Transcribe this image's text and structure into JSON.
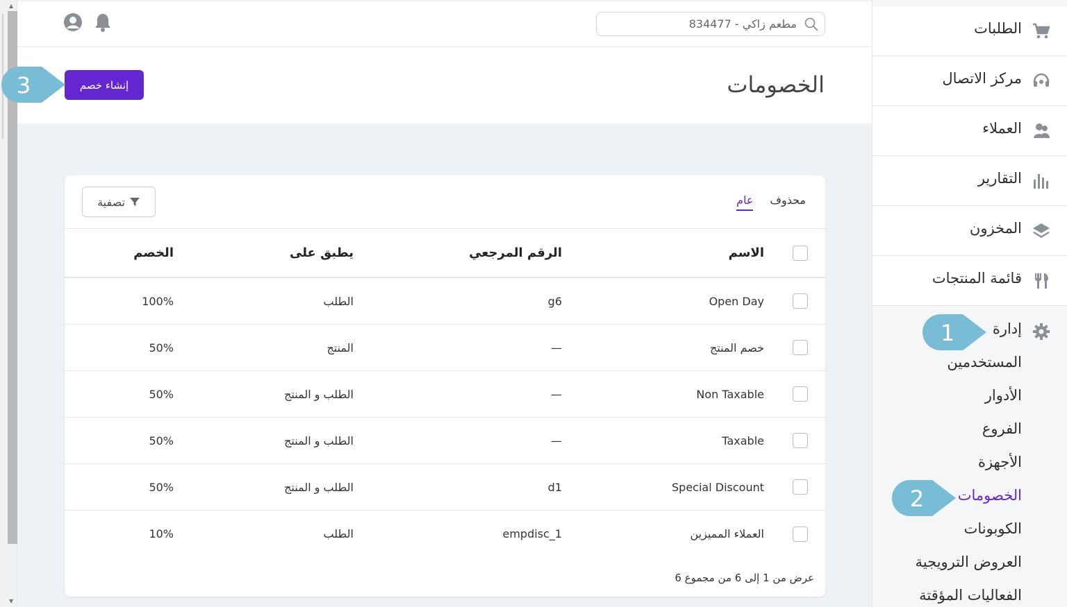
{
  "colors": {
    "accent": "#6326d1",
    "callout": "#79bcd6",
    "page_bg": "#eff2f5"
  },
  "topbar": {
    "search_value": "مطعم زاكي - 834477",
    "icons": [
      "bell-icon",
      "user-avatar-icon"
    ]
  },
  "header": {
    "title": "الخصومات",
    "create_button": "إنشاء خصم"
  },
  "tabs": [
    {
      "label": "عام",
      "active": true
    },
    {
      "label": "محذوف",
      "active": false
    }
  ],
  "filter_button": "تصفية",
  "table": {
    "columns": [
      "الاسم",
      "الرقم المرجعي",
      "يطبق على",
      "الخصم"
    ],
    "rows": [
      {
        "name": "Open Day",
        "ref": "g6",
        "applies_to": "الطلب",
        "discount": "100%"
      },
      {
        "name": "خصم المنتج",
        "ref": "—",
        "applies_to": "المنتج",
        "discount": "50%"
      },
      {
        "name": "Non Taxable",
        "ref": "—",
        "applies_to": "الطلب و المنتج",
        "discount": "50%"
      },
      {
        "name": "Taxable",
        "ref": "—",
        "applies_to": "الطلب و المنتج",
        "discount": "50%"
      },
      {
        "name": "Special Discount",
        "ref": "d1",
        "applies_to": "الطلب و المنتج",
        "discount": "50%"
      },
      {
        "name": "العملاء المميزين",
        "ref": "empdisc_1",
        "applies_to": "الطلب",
        "discount": "10%"
      }
    ],
    "footer": "عرض من 1 إلى 6 من مجموع 6"
  },
  "sidebar": {
    "items": [
      {
        "label": "الطلبات",
        "icon": "cart-icon"
      },
      {
        "label": "مركز الاتصال",
        "icon": "headset-icon"
      },
      {
        "label": "العملاء",
        "icon": "customers-icon"
      },
      {
        "label": "التقارير",
        "icon": "bar-chart-icon"
      },
      {
        "label": "المخزون",
        "icon": "layers-icon"
      },
      {
        "label": "قائمة المنتجات",
        "icon": "utensils-icon"
      }
    ],
    "admin": {
      "label": "إدارة",
      "icon": "gear-icon",
      "sub_items": [
        {
          "label": "المستخدمين",
          "active": false
        },
        {
          "label": "الأدوار",
          "active": false
        },
        {
          "label": "الفروع",
          "active": false
        },
        {
          "label": "الأجهزة",
          "active": false
        },
        {
          "label": "الخصومات",
          "active": true
        },
        {
          "label": "الكوبونات",
          "active": false
        },
        {
          "label": "العروض الترويجية",
          "active": false
        },
        {
          "label": "الفعاليات المؤقتة",
          "active": false
        }
      ]
    }
  },
  "callouts": [
    "1",
    "2",
    "3"
  ]
}
